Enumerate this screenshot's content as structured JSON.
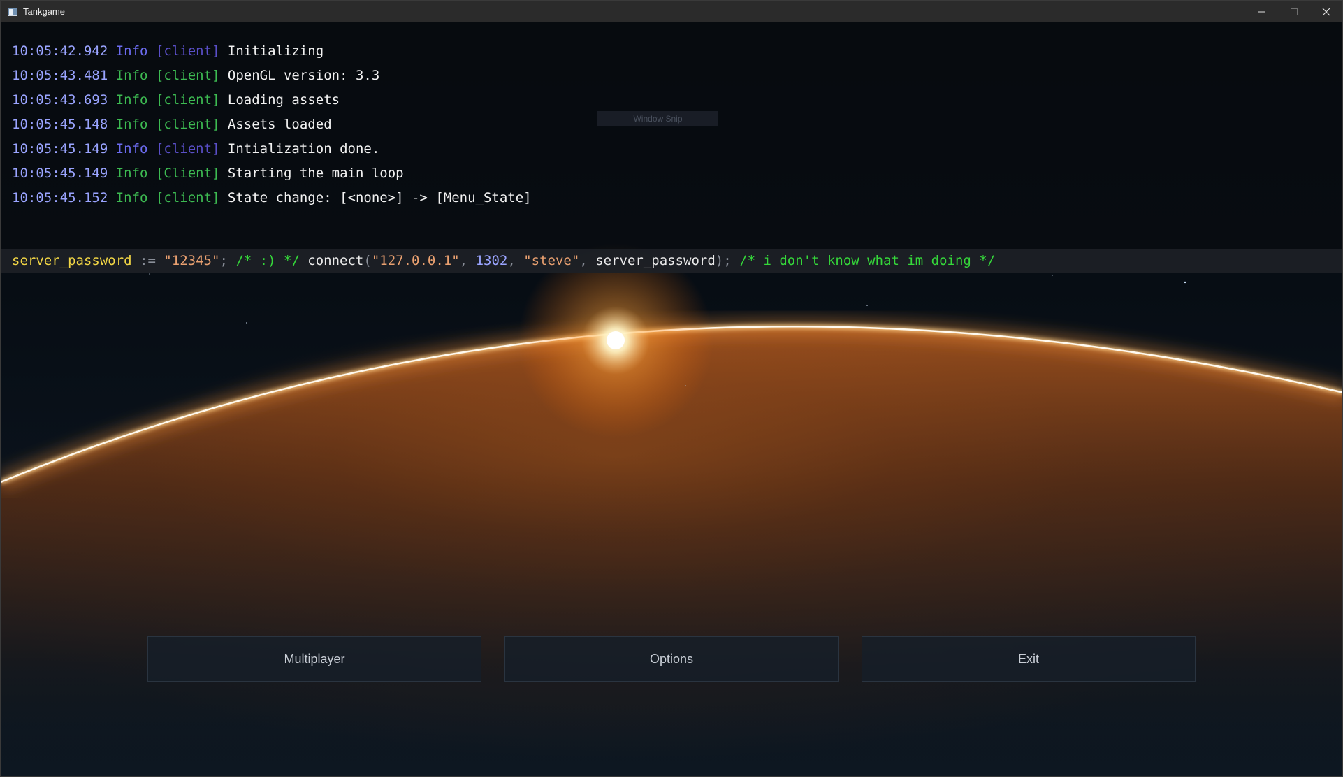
{
  "window": {
    "title": "Tankgame",
    "controls": {
      "minimize_icon": "minimize-icon",
      "maximize_icon": "maximize-icon",
      "close_icon": "close-icon"
    }
  },
  "console": {
    "lines": [
      {
        "time": "10:05:42.942",
        "level": "Info",
        "tag": "[client]",
        "message": "Initializing",
        "style": "a"
      },
      {
        "time": "10:05:43.481",
        "level": "Info",
        "tag": "[client]",
        "message": "OpenGL version: 3.3",
        "style": "b"
      },
      {
        "time": "10:05:43.693",
        "level": "Info",
        "tag": "[client]",
        "message": "Loading assets",
        "style": "b"
      },
      {
        "time": "10:05:45.148",
        "level": "Info",
        "tag": "[client]",
        "message": "Assets loaded",
        "style": "b"
      },
      {
        "time": "10:05:45.149",
        "level": "Info",
        "tag": "[client]",
        "message": "Intialization done.",
        "style": "a"
      },
      {
        "time": "10:05:45.149",
        "level": "Info",
        "tag": "[Client]",
        "message": "Starting the main loop",
        "style": "b"
      },
      {
        "time": "10:05:45.152",
        "level": "Info",
        "tag": "[client]",
        "message": "State change: [<none>] -> [Menu_State]",
        "style": "b"
      }
    ],
    "input": {
      "ident": "server_password",
      "assign": " := ",
      "str1": "\"12345\"",
      "semi1": "; ",
      "comment1": "/* :) */",
      "space1": " ",
      "func": "connect",
      "paren_open": "(",
      "str2": "\"127.0.0.1\"",
      "comma1": ", ",
      "num": "1302",
      "comma2": ", ",
      "str3": "\"steve\"",
      "comma3": ", ",
      "arg": "server_password",
      "paren_close": ");",
      "space2": " ",
      "comment2": "/* i don't know what im doing */"
    }
  },
  "overlay": {
    "snip_label": "Window Snip"
  },
  "menu": {
    "multiplayer": "Multiplayer",
    "options": "Options",
    "exit": "Exit"
  }
}
